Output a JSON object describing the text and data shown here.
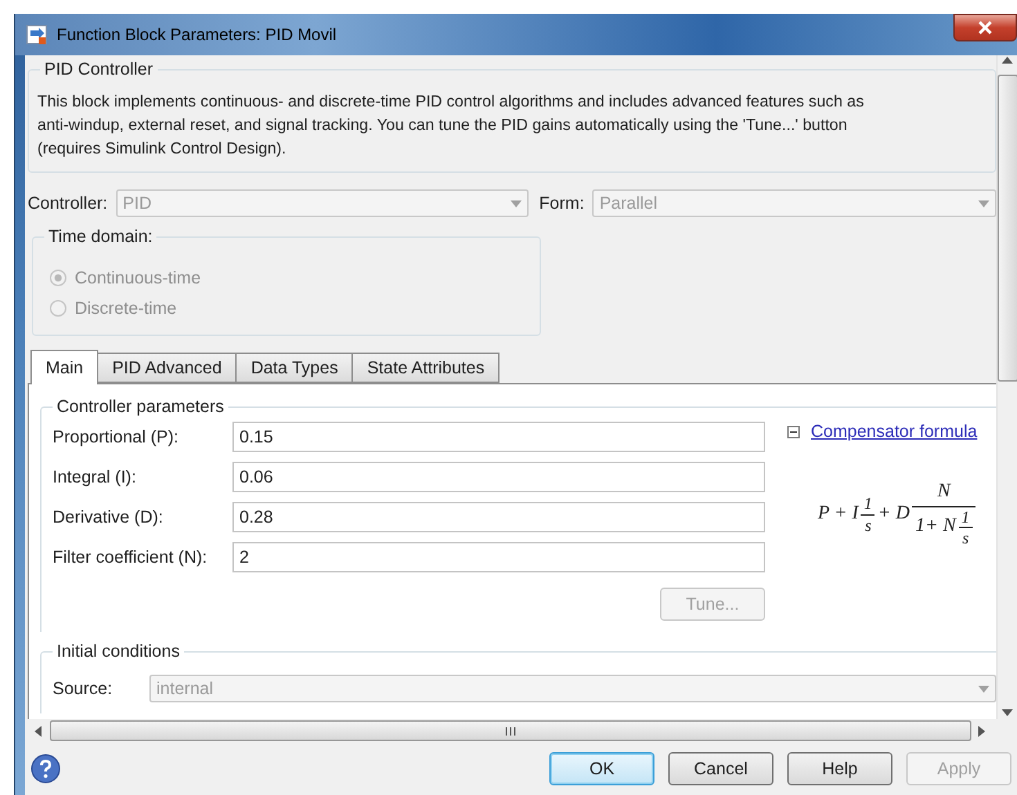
{
  "window": {
    "title": "Function Block Parameters: PID Movil"
  },
  "block": {
    "name": "PID Controller",
    "description_lines": [
      "This block implements continuous- and discrete-time PID control algorithms and includes advanced features such as",
      "anti-windup, external reset, and signal tracking. You can tune the PID gains automatically using the 'Tune...' button",
      "(requires Simulink Control Design)."
    ]
  },
  "controller": {
    "label": "Controller:",
    "value": "PID",
    "disabled": true
  },
  "form": {
    "label": "Form:",
    "value": "Parallel",
    "disabled": true
  },
  "time_domain": {
    "title": "Time domain:",
    "options": [
      {
        "label": "Continuous-time",
        "selected": true,
        "disabled": true
      },
      {
        "label": "Discrete-time",
        "selected": false,
        "disabled": true
      }
    ]
  },
  "tabs": [
    {
      "label": "Main",
      "selected": true
    },
    {
      "label": "PID Advanced",
      "selected": false
    },
    {
      "label": "Data Types",
      "selected": false
    },
    {
      "label": "State Attributes",
      "selected": false
    }
  ],
  "controller_parameters": {
    "title": "Controller parameters",
    "fields": [
      {
        "label": "Proportional (P):",
        "value": "0.15"
      },
      {
        "label": "Integral (I):",
        "value": "0.06"
      },
      {
        "label": "Derivative (D):",
        "value": "0.28"
      },
      {
        "label": "Filter coefficient (N):",
        "value": "2"
      }
    ],
    "tune_button": {
      "label": "Tune...",
      "disabled": true
    },
    "formula_expanded": true,
    "formula_link": "Compensator formula",
    "formula": {
      "lead": "P + I",
      "frac1": [
        "1",
        "s"
      ],
      "mid": "+ D",
      "numerator": "N",
      "denominator_lead": "1+ N",
      "frac2": [
        "1",
        "s"
      ]
    }
  },
  "initial_conditions": {
    "title": "Initial conditions",
    "source": {
      "label": "Source:",
      "value": "internal",
      "disabled": true
    }
  },
  "buttons": [
    {
      "label": "OK",
      "default": true,
      "disabled": false
    },
    {
      "label": "Cancel",
      "default": false,
      "disabled": false
    },
    {
      "label": "Help",
      "default": false,
      "disabled": false
    },
    {
      "label": "Apply",
      "default": false,
      "disabled": true
    }
  ]
}
